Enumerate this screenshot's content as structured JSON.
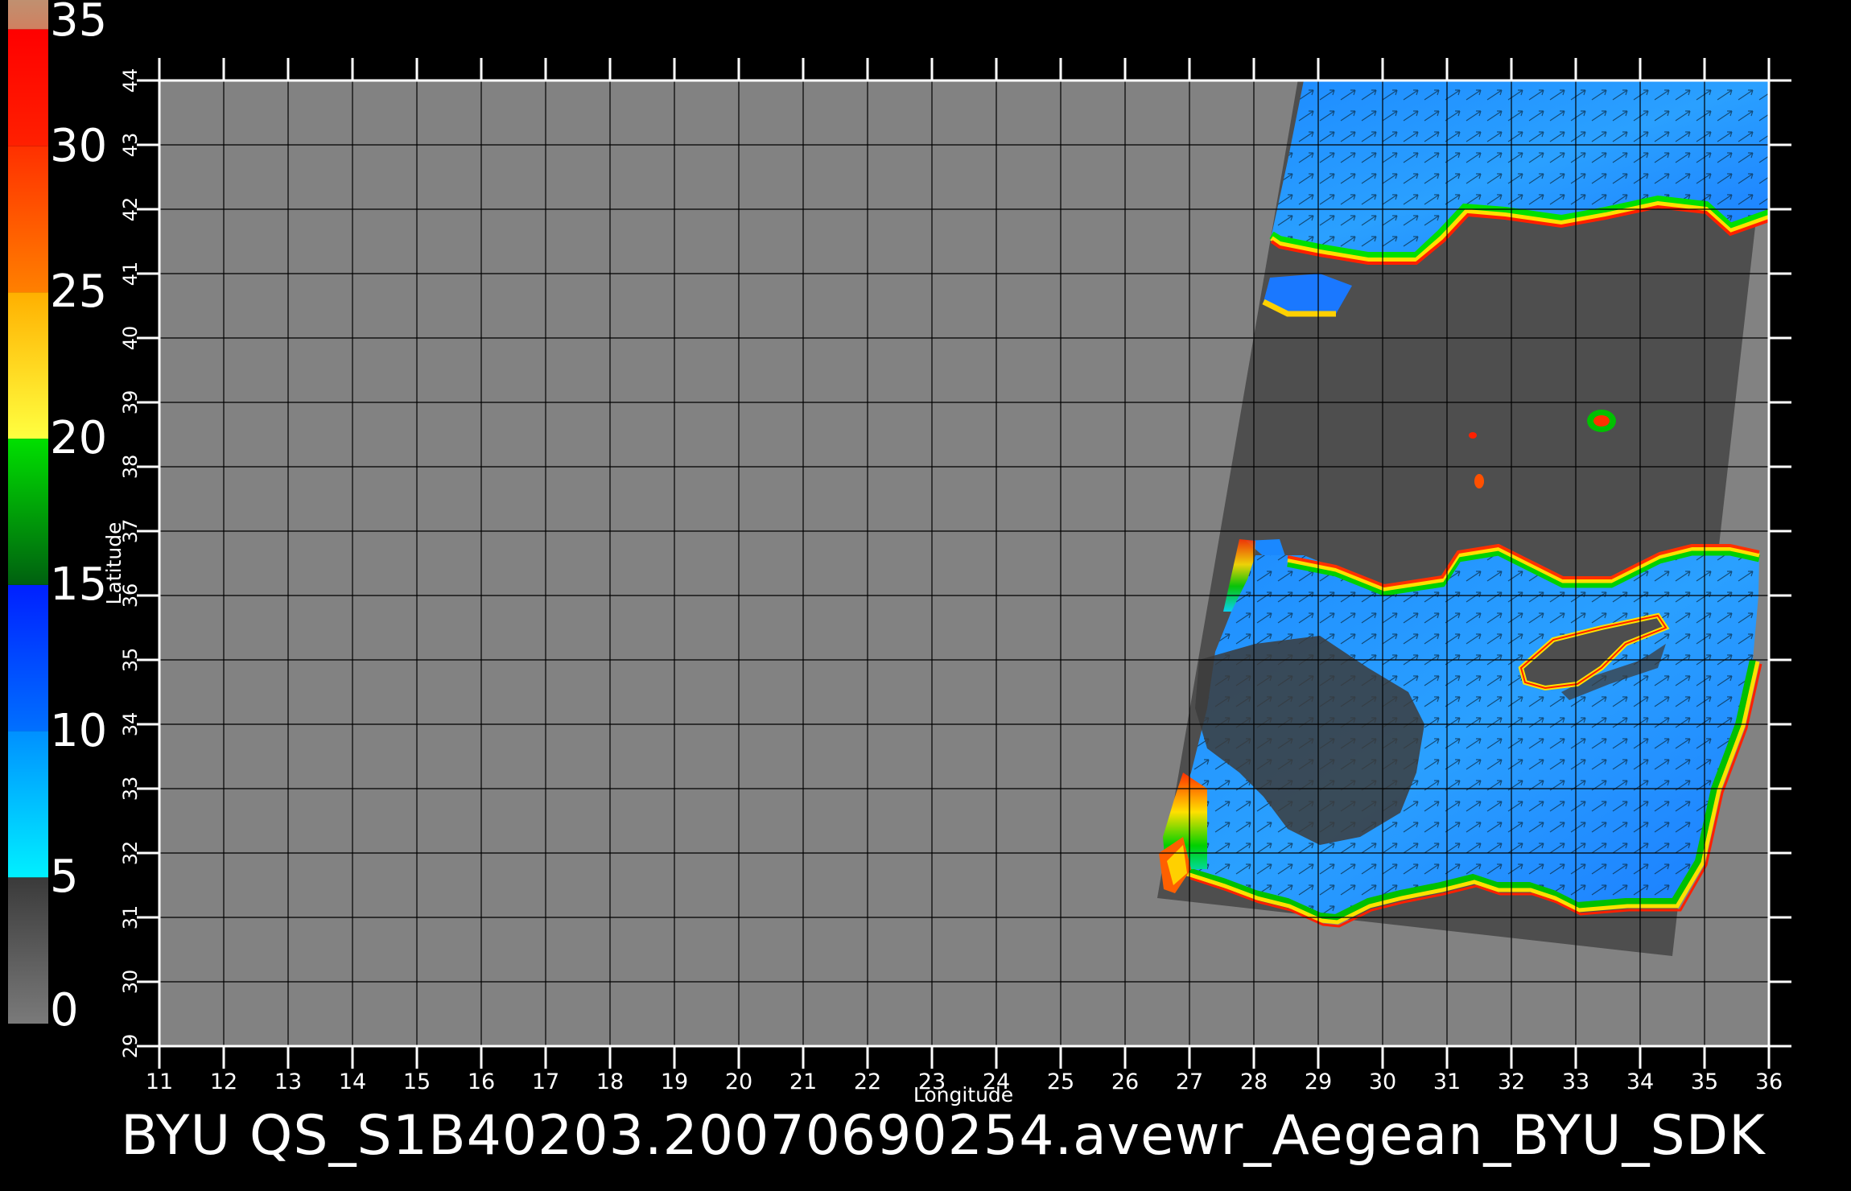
{
  "colorbar": {
    "ticks": [
      "35",
      "30",
      "25",
      "20",
      "15",
      "10",
      "5",
      "0"
    ],
    "range": [
      0,
      35
    ],
    "bands": [
      {
        "from": 0,
        "to": 5,
        "colors": [
          "#7a7a7a",
          "#3a3a3a"
        ]
      },
      {
        "from": 5,
        "to": 10,
        "colors": [
          "#00f0ff",
          "#0090ff"
        ]
      },
      {
        "from": 10,
        "to": 15,
        "colors": [
          "#0070ff",
          "#0020ff"
        ]
      },
      {
        "from": 15,
        "to": 20,
        "colors": [
          "#006010",
          "#00e000"
        ]
      },
      {
        "from": 20,
        "to": 25,
        "colors": [
          "#ffff40",
          "#ffb000"
        ]
      },
      {
        "from": 25,
        "to": 30,
        "colors": [
          "#ff8000",
          "#ff3000"
        ]
      },
      {
        "from": 30,
        "to": 34,
        "colors": [
          "#ff2000",
          "#ff0000"
        ]
      },
      {
        "from": 34,
        "to": 35,
        "colors": [
          "#d08060",
          "#c09070"
        ]
      }
    ]
  },
  "map": {
    "xlabel": "Longitude",
    "ylabel": "Latitude",
    "lon_range": [
      11,
      36
    ],
    "lat_range": [
      29,
      44
    ],
    "lon_ticks": [
      "11",
      "12",
      "13",
      "14",
      "15",
      "16",
      "17",
      "18",
      "19",
      "20",
      "21",
      "22",
      "23",
      "24",
      "25",
      "26",
      "27",
      "28",
      "29",
      "30",
      "31",
      "32",
      "33",
      "34",
      "35",
      "36"
    ],
    "lat_ticks": [
      "29",
      "30",
      "31",
      "32",
      "33",
      "34",
      "35",
      "36",
      "37",
      "38",
      "39",
      "40",
      "41",
      "42",
      "43",
      "44"
    ],
    "background_color": "#828282",
    "swath_color": "#4e4e4e",
    "swath_corners": [
      [
        28.7,
        44.1
      ],
      [
        36.0,
        43.6
      ],
      [
        34.5,
        30.4
      ],
      [
        26.5,
        31.3
      ]
    ]
  },
  "title": "BYU  QS_S1B40203.20070690254.avewr_Aegean_BYU_SDK"
}
